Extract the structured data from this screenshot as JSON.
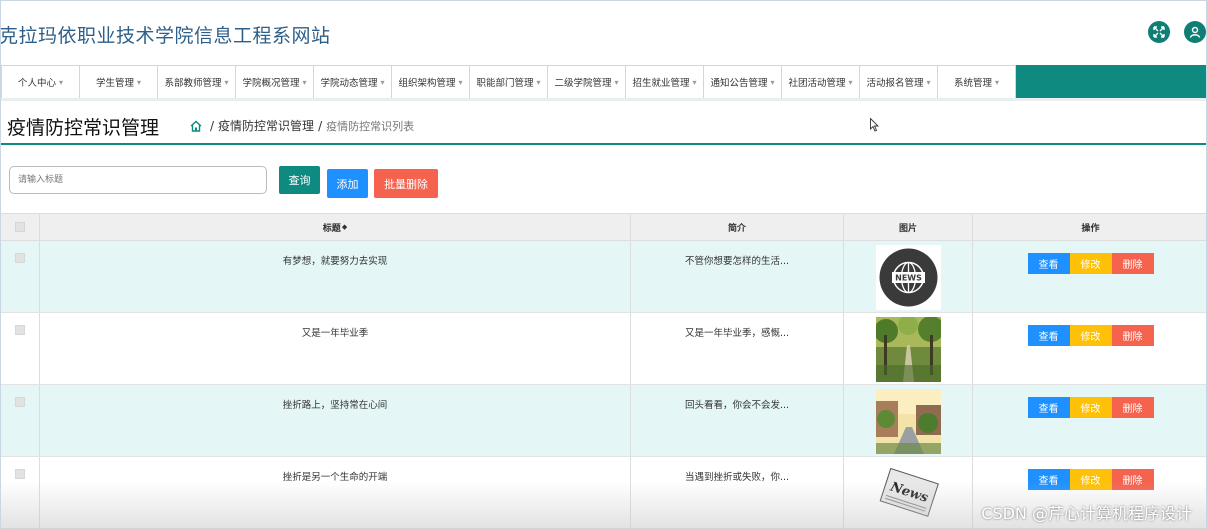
{
  "site": {
    "title": "克拉玛依职业技术学院信息工程系网站"
  },
  "header_icons": [
    "expand-icon",
    "user-icon"
  ],
  "nav": {
    "items": [
      {
        "label": "个人中心"
      },
      {
        "label": "学生管理"
      },
      {
        "label": "系部教师管理"
      },
      {
        "label": "学院概况管理"
      },
      {
        "label": "学院动态管理"
      },
      {
        "label": "组织架构管理"
      },
      {
        "label": "职能部门管理"
      },
      {
        "label": "二级学院管理"
      },
      {
        "label": "招生就业管理"
      },
      {
        "label": "通知公告管理"
      },
      {
        "label": "社团活动管理"
      },
      {
        "label": "活动报名管理"
      },
      {
        "label": "系统管理"
      }
    ]
  },
  "page": {
    "title": "疫情防控常识管理",
    "breadcrumb": [
      "疫情防控常识管理",
      "疫情防控常识列表"
    ],
    "separator": "/"
  },
  "search": {
    "placeholder": "请输入标题"
  },
  "buttons": {
    "query": "查询",
    "add": "添加",
    "batch_delete": "批量删除"
  },
  "table": {
    "columns": {
      "title": "标题",
      "title_sort": "◆",
      "intro": "简介",
      "pic": "图片",
      "ops": "操作"
    },
    "rows": [
      {
        "title": "有梦想，就要努力去实现",
        "intro": "不管你想要怎样的生活...",
        "pic": "news-globe-icon"
      },
      {
        "title": "又是一年毕业季",
        "intro": "又是一年毕业季，感慨...",
        "pic": "tree-road-photo"
      },
      {
        "title": "挫折路上，坚持常在心间",
        "intro": "回头看看，你会不会发...",
        "pic": "campus-street-photo"
      },
      {
        "title": "挫折是另一个生命的开端",
        "intro": "当遇到挫折或失败，你...",
        "pic": "newspaper-photo"
      }
    ],
    "ops": {
      "view": "查看",
      "edit": "修改",
      "delete": "删除"
    }
  },
  "watermark": "CSDN @芹心计算机程序设计",
  "colors": {
    "primary": "#0f8a80",
    "blue": "#1e90ff",
    "yellow": "#ffc107",
    "red": "#f5624e",
    "row_alt": "#e4f6f6"
  }
}
